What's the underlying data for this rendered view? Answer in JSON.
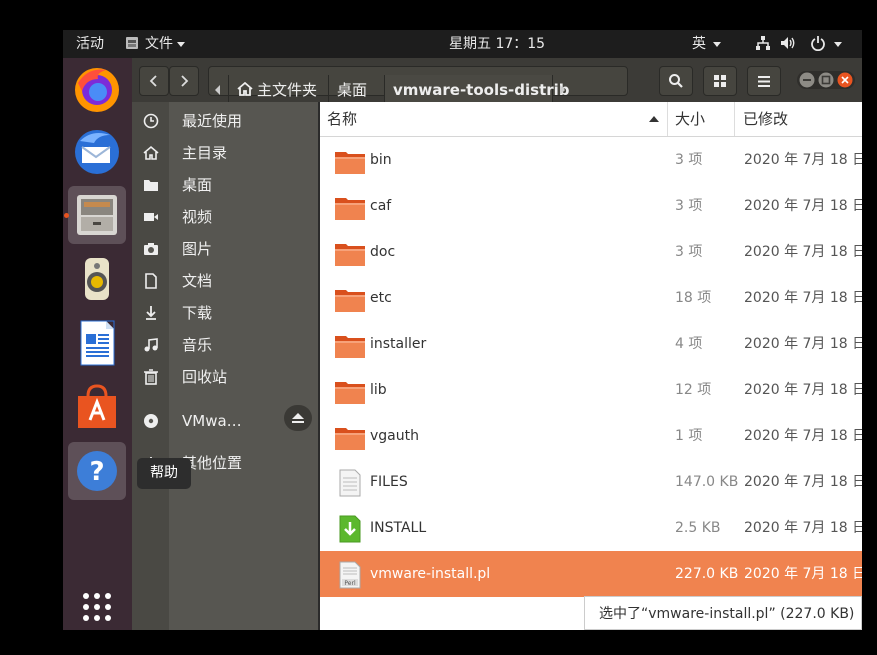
{
  "topbar": {
    "activities": "活动",
    "app_menu": "文件",
    "clock": "星期五 17：15",
    "input_method": "英"
  },
  "dock": {
    "apps": [
      {
        "name": "Firefox",
        "icon": "firefox-icon"
      },
      {
        "name": "Thunderbird",
        "icon": "thunderbird-icon"
      },
      {
        "name": "文件",
        "icon": "files-icon"
      },
      {
        "name": "Rhythmbox",
        "icon": "rhythmbox-icon"
      },
      {
        "name": "LibreOffice Writer",
        "icon": "writer-icon"
      },
      {
        "name": "Ubuntu Software",
        "icon": "software-icon"
      },
      {
        "name": "帮助",
        "icon": "help-icon"
      }
    ],
    "tooltip": "帮助"
  },
  "path": {
    "home": "主文件夹",
    "desktop": "桌面",
    "current": "vmware-tools-distrib"
  },
  "sidebar": {
    "items": [
      {
        "label": "最近使用",
        "icon": "clock-icon"
      },
      {
        "label": "主目录",
        "icon": "home-icon"
      },
      {
        "label": "桌面",
        "icon": "folder-icon"
      },
      {
        "label": "视频",
        "icon": "video-icon"
      },
      {
        "label": "图片",
        "icon": "camera-icon"
      },
      {
        "label": "文档",
        "icon": "document-icon"
      },
      {
        "label": "下载",
        "icon": "download-icon"
      },
      {
        "label": "音乐",
        "icon": "music-icon"
      },
      {
        "label": "回收站",
        "icon": "trash-icon"
      },
      {
        "label": "VMwa…",
        "icon": "disc-icon"
      },
      {
        "label": "其他位置",
        "icon": "plus-icon"
      }
    ]
  },
  "columns": {
    "name": "名称",
    "size": "大小",
    "modified": "已修改"
  },
  "files": [
    {
      "name": "bin",
      "size": "3 项",
      "modified": "2020 年 7月 18 日",
      "type": "folder"
    },
    {
      "name": "caf",
      "size": "3 项",
      "modified": "2020 年 7月 18 日",
      "type": "folder"
    },
    {
      "name": "doc",
      "size": "3 项",
      "modified": "2020 年 7月 18 日",
      "type": "folder"
    },
    {
      "name": "etc",
      "size": "18 项",
      "modified": "2020 年 7月 18 日",
      "type": "folder"
    },
    {
      "name": "installer",
      "size": "4 项",
      "modified": "2020 年 7月 18 日",
      "type": "folder"
    },
    {
      "name": "lib",
      "size": "12 项",
      "modified": "2020 年 7月 18 日",
      "type": "folder"
    },
    {
      "name": "vgauth",
      "size": "1 项",
      "modified": "2020 年 7月 18 日",
      "type": "folder"
    },
    {
      "name": "FILES",
      "size": "147.0 KB",
      "modified": "2020 年 7月 18 日",
      "type": "text"
    },
    {
      "name": "INSTALL",
      "size": "2.5 KB",
      "modified": "2020 年 7月 18 日",
      "type": "install"
    },
    {
      "name": "vmware-install.pl",
      "size": "227.0 KB",
      "modified": "2020 年 7月 18 日",
      "type": "perl",
      "selected": true
    }
  ],
  "status": "选中了“vmware-install.pl” (227.0 KB)",
  "colors": {
    "accent": "#e95420",
    "selection": "#f0834f",
    "folder": "#e9643a"
  }
}
